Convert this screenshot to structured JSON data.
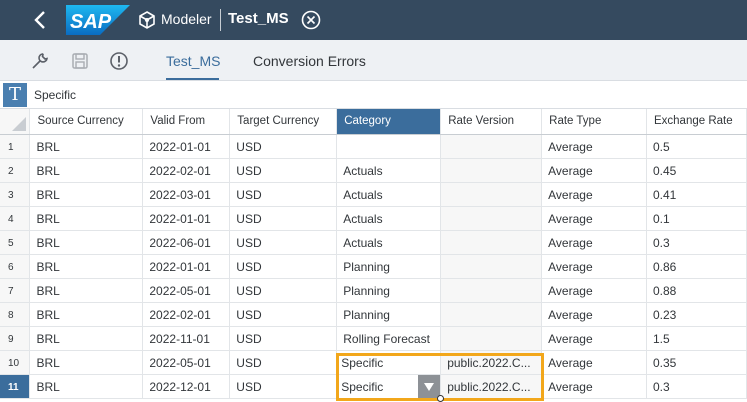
{
  "shell": {
    "app_name": "Modeler",
    "doc_title": "Test_MS",
    "logo_text": "SAP",
    "brand_color": "#354a5f"
  },
  "toolbar": {
    "icons": [
      "wrench-icon",
      "save-icon",
      "info-icon"
    ],
    "tabs": [
      {
        "label": "Test_MS",
        "active": true
      },
      {
        "label": "Conversion Errors",
        "active": false
      }
    ],
    "accent": "#3b6d9c"
  },
  "formula_bar": {
    "icon_text": "T",
    "value": "Specific"
  },
  "grid": {
    "columns": [
      "Source Currency",
      "Valid From",
      "Target Currency",
      "Category",
      "Rate Version",
      "Rate Type",
      "Exchange Rate"
    ],
    "selected_column": "Category",
    "current_row": "11",
    "rows": [
      {
        "n": "1",
        "src": "BRL",
        "from": "2022-01-01",
        "tgt": "USD",
        "cat": "",
        "ver": "",
        "type": "Average",
        "rate": "0.5"
      },
      {
        "n": "2",
        "src": "BRL",
        "from": "2022-02-01",
        "tgt": "USD",
        "cat": "Actuals",
        "ver": "",
        "type": "Average",
        "rate": "0.45"
      },
      {
        "n": "3",
        "src": "BRL",
        "from": "2022-03-01",
        "tgt": "USD",
        "cat": "Actuals",
        "ver": "",
        "type": "Average",
        "rate": "0.41"
      },
      {
        "n": "4",
        "src": "BRL",
        "from": "2022-01-01",
        "tgt": "USD",
        "cat": "Actuals",
        "ver": "",
        "type": "Average",
        "rate": "0.1"
      },
      {
        "n": "5",
        "src": "BRL",
        "from": "2022-06-01",
        "tgt": "USD",
        "cat": "Actuals",
        "ver": "",
        "type": "Average",
        "rate": "0.3"
      },
      {
        "n": "6",
        "src": "BRL",
        "from": "2022-01-01",
        "tgt": "USD",
        "cat": "Planning",
        "ver": "",
        "type": "Average",
        "rate": "0.86"
      },
      {
        "n": "7",
        "src": "BRL",
        "from": "2022-05-01",
        "tgt": "USD",
        "cat": "Planning",
        "ver": "",
        "type": "Average",
        "rate": "0.88"
      },
      {
        "n": "8",
        "src": "BRL",
        "from": "2022-02-01",
        "tgt": "USD",
        "cat": "Planning",
        "ver": "",
        "type": "Average",
        "rate": "0.23"
      },
      {
        "n": "9",
        "src": "BRL",
        "from": "2022-11-01",
        "tgt": "USD",
        "cat": "Rolling Forecast",
        "ver": "",
        "type": "Average",
        "rate": "1.5"
      },
      {
        "n": "10",
        "src": "BRL",
        "from": "2022-05-01",
        "tgt": "USD",
        "cat": "Specific",
        "ver": "public.2022.C...",
        "type": "Average",
        "rate": "0.35"
      },
      {
        "n": "11",
        "src": "BRL",
        "from": "2022-12-01",
        "tgt": "USD",
        "cat": "Specific",
        "ver": "public.2022.C...",
        "type": "Average",
        "rate": "0.3"
      }
    ]
  },
  "highlight_color": "#f2a71b"
}
